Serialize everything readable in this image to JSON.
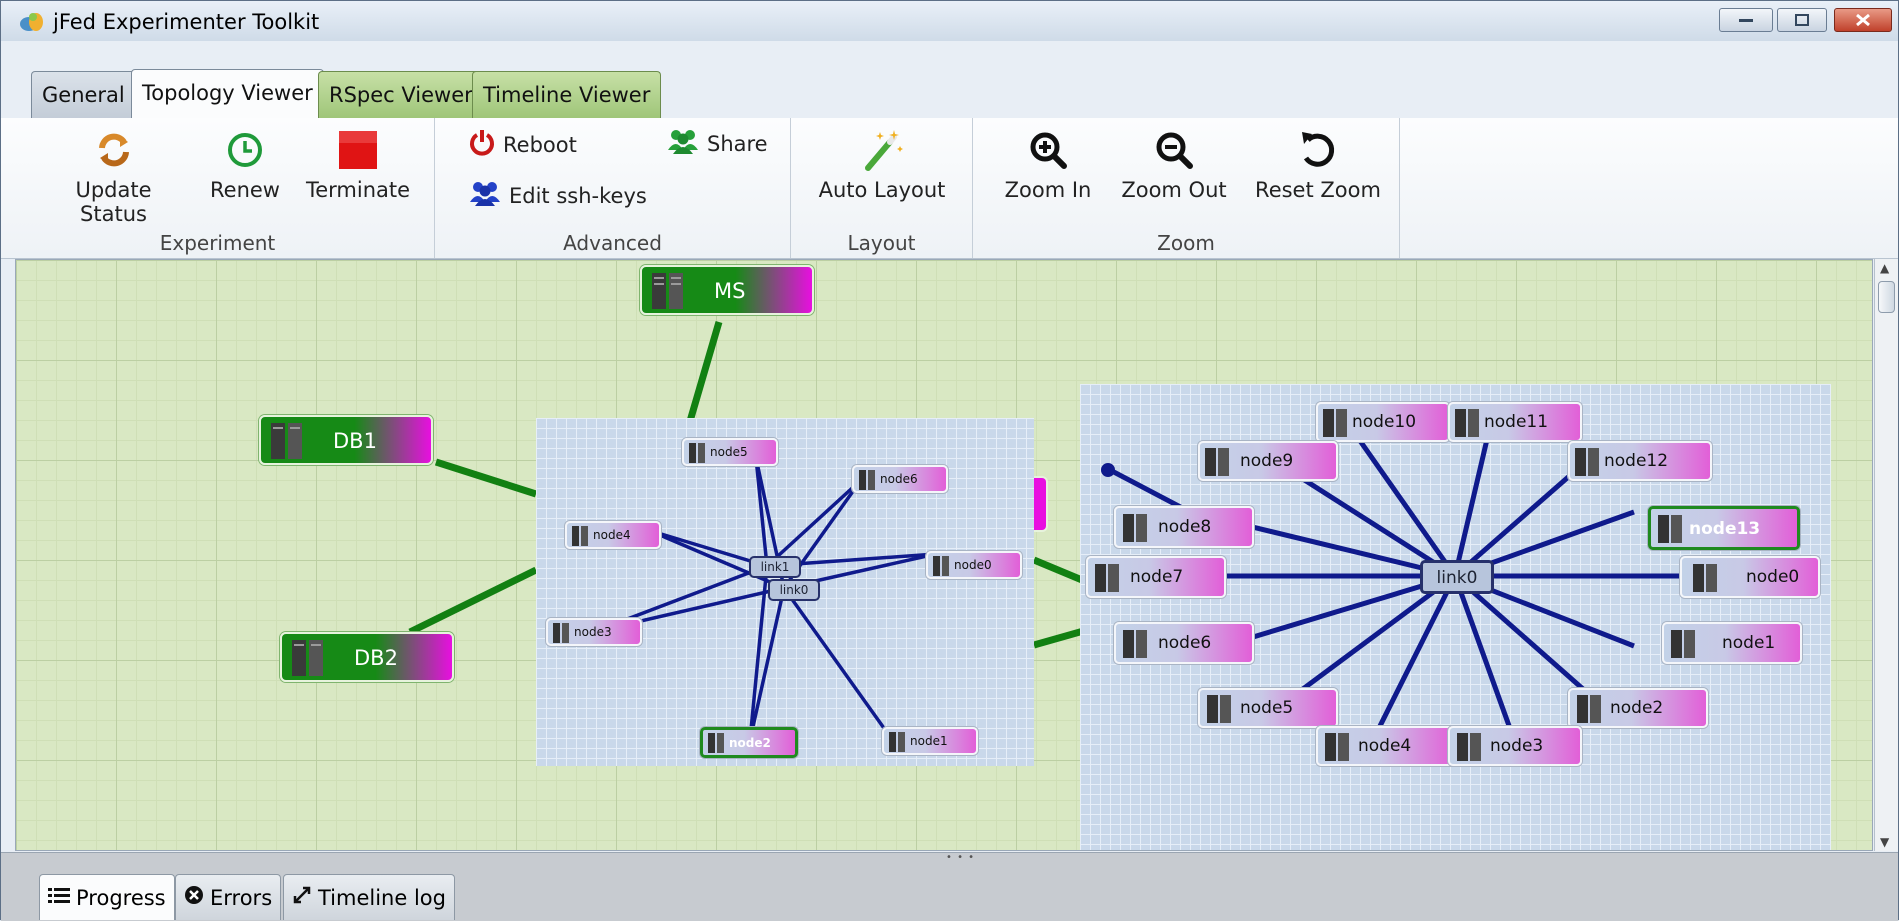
{
  "window": {
    "title": "jFed Experimenter Toolkit"
  },
  "tabs": [
    {
      "label": "General"
    },
    {
      "label": "Topology Viewer"
    },
    {
      "label": "RSpec Viewer"
    },
    {
      "label": "Timeline Viewer"
    }
  ],
  "ribbon": {
    "experiment": {
      "label": "Experiment",
      "update_status": "Update Status",
      "renew": "Renew",
      "terminate": "Terminate"
    },
    "advanced": {
      "label": "Advanced",
      "reboot": "Reboot",
      "share": "Share",
      "edit_ssh_keys": "Edit ssh-keys"
    },
    "layout": {
      "label": "Layout",
      "auto_layout": "Auto Layout"
    },
    "zoom": {
      "label": "Zoom",
      "zoom_in": "Zoom In",
      "zoom_out": "Zoom Out",
      "reset_zoom": "Reset Zoom"
    }
  },
  "topology": {
    "main_nodes": {
      "ms": "MS",
      "db1": "DB1",
      "db2": "DB2"
    },
    "left_cluster": {
      "links": {
        "link1": "link1",
        "link0": "link0"
      },
      "nodes": {
        "node0": "node0",
        "node1": "node1",
        "node2": "node2",
        "node3": "node3",
        "node4": "node4",
        "node5": "node5",
        "node6": "node6"
      }
    },
    "right_cluster": {
      "link": "link0",
      "nodes": {
        "node0": "node0",
        "node1": "node1",
        "node2": "node2",
        "node3": "node3",
        "node4": "node4",
        "node5": "node5",
        "node6": "node6",
        "node7": "node7",
        "node8": "node8",
        "node9": "node9",
        "node10": "node10",
        "node11": "node11",
        "node12": "node12",
        "node13": "node13"
      }
    }
  },
  "bottom_tabs": {
    "progress": "Progress",
    "errors": "Errors",
    "timeline_log": "Timeline log"
  },
  "colors": {
    "accent_green": "#168a16",
    "node_magenta": "#e80fe0",
    "link_blue": "#0f1a8c"
  }
}
